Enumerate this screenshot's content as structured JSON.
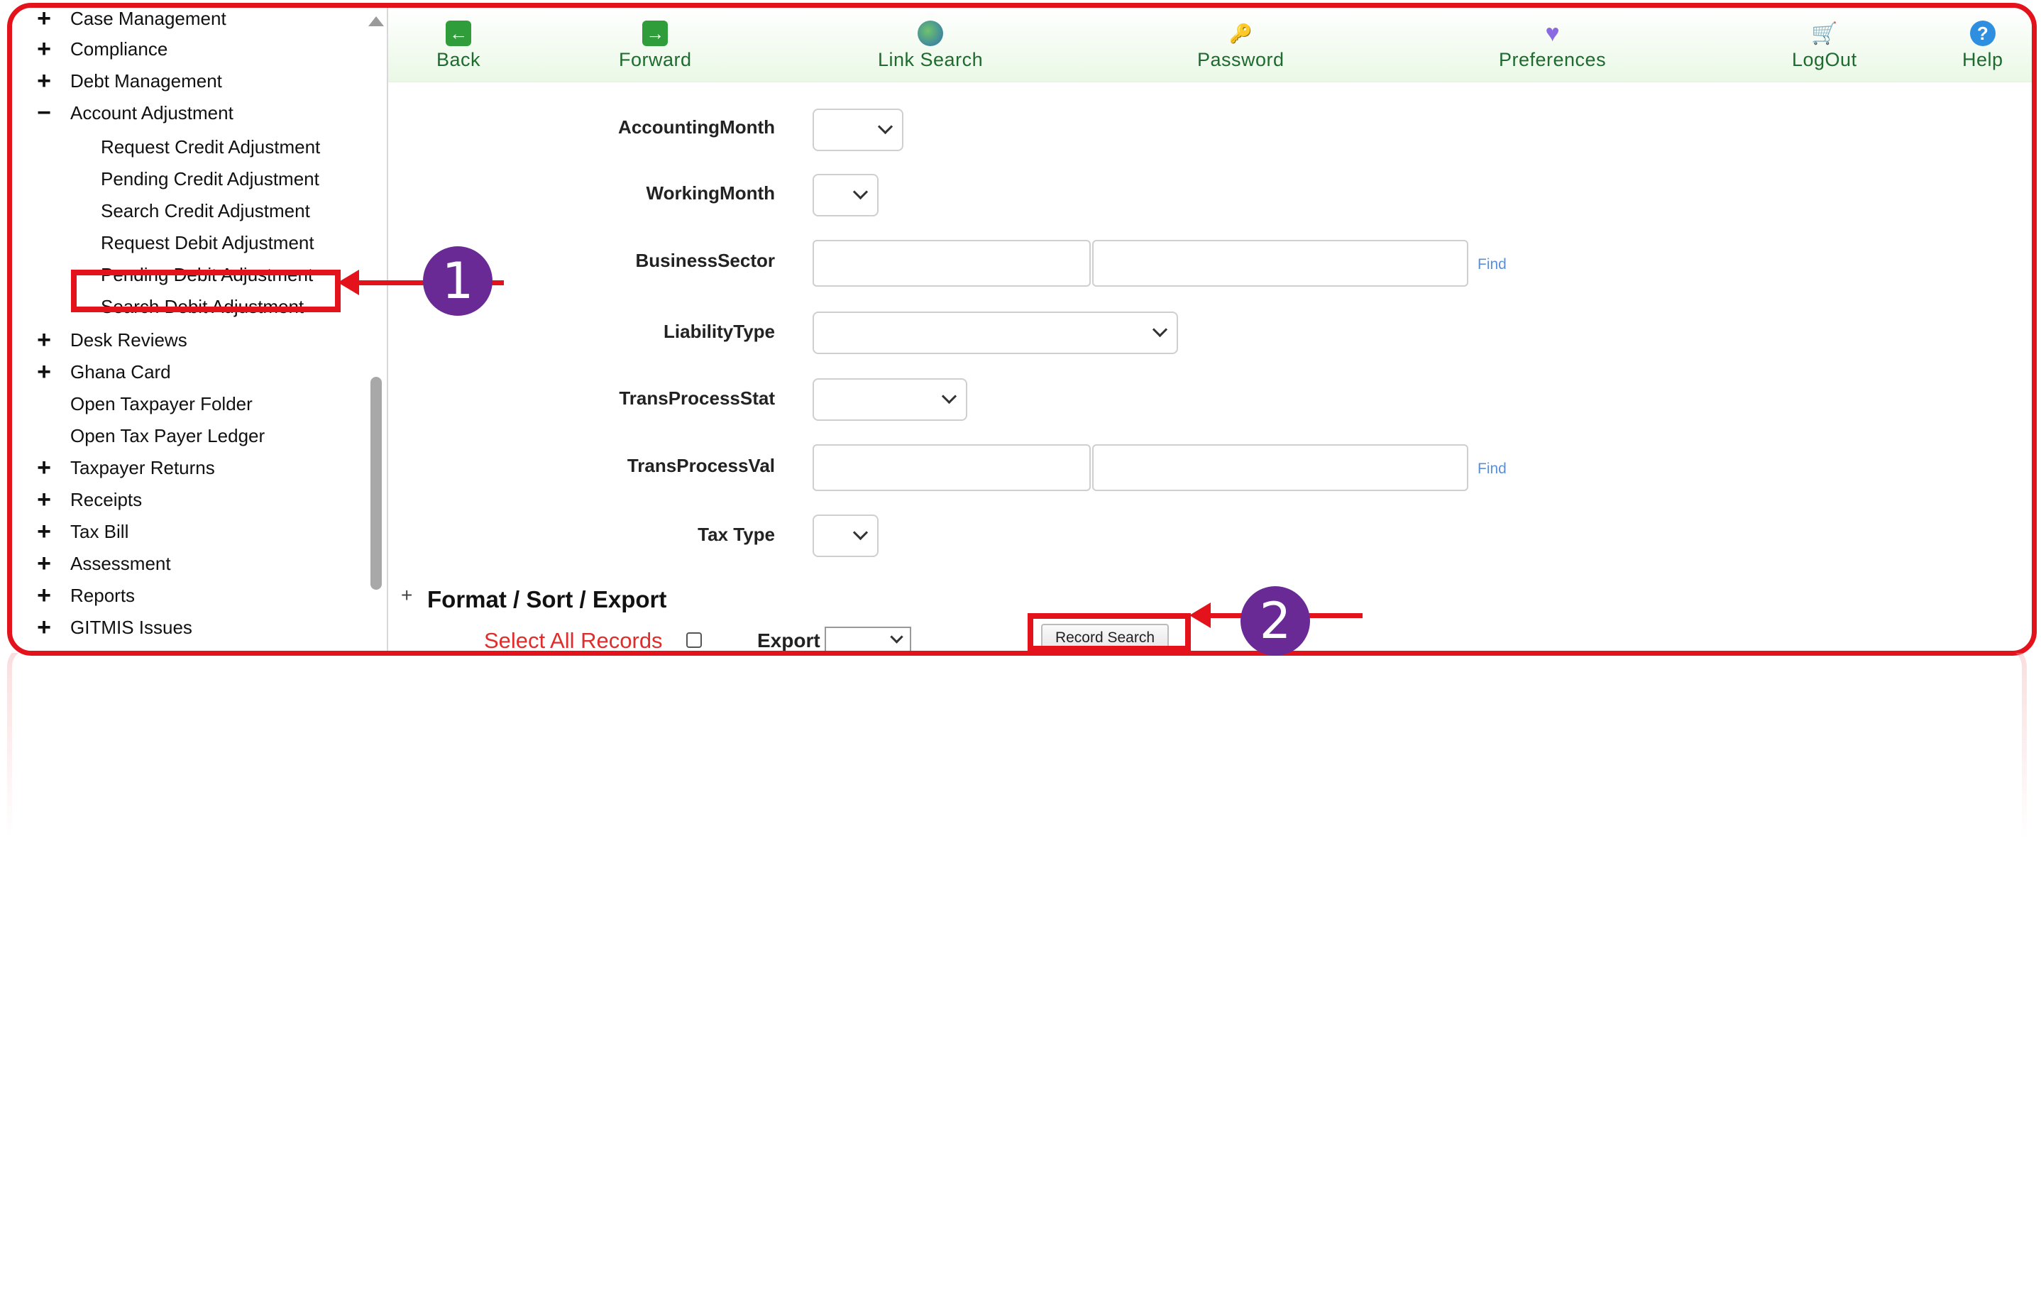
{
  "sidebar": {
    "items": [
      {
        "label": "Case Management",
        "sign": "+"
      },
      {
        "label": "Compliance",
        "sign": "+"
      },
      {
        "label": "Debt Management",
        "sign": "+"
      },
      {
        "label": "Account Adjustment",
        "sign": "−"
      },
      {
        "label": "Request Credit Adjustment",
        "sign": ""
      },
      {
        "label": "Pending Credit Adjustment",
        "sign": ""
      },
      {
        "label": "Search Credit Adjustment",
        "sign": ""
      },
      {
        "label": "Request Debit Adjustment",
        "sign": ""
      },
      {
        "label": "Pending Debit Adjustment",
        "sign": ""
      },
      {
        "label": "Search Debit Adjustment",
        "sign": ""
      },
      {
        "label": "Desk Reviews",
        "sign": "+"
      },
      {
        "label": "Ghana Card",
        "sign": "+"
      },
      {
        "label": "Open Taxpayer Folder",
        "sign": ""
      },
      {
        "label": "Open Tax Payer Ledger",
        "sign": ""
      },
      {
        "label": "Taxpayer Returns",
        "sign": "+"
      },
      {
        "label": "Receipts",
        "sign": "+"
      },
      {
        "label": "Tax Bill",
        "sign": "+"
      },
      {
        "label": "Assessment",
        "sign": "+"
      },
      {
        "label": "Reports",
        "sign": "+"
      },
      {
        "label": "GITMIS Issues",
        "sign": "+"
      }
    ]
  },
  "toolbar": {
    "back": "Back",
    "forward": "Forward",
    "link_search": "Link Search",
    "password": "Password",
    "preferences": "Preferences",
    "logout": "LogOut",
    "help": "Help"
  },
  "form": {
    "accounting_month": "AccountingMonth",
    "working_month": "WorkingMonth",
    "business_sector": "BusinessSector",
    "liability_type": "LiabilityType",
    "trans_process_stat": "TransProcessStat",
    "trans_process_val": "TransProcessVal",
    "tax_type": "Tax Type",
    "find": "Find"
  },
  "format_section": {
    "plus": "+",
    "title": "Format / Sort / Export",
    "select_all": "Select All Records",
    "export_label": "Export",
    "record_search": "Record Search"
  },
  "annotations": {
    "step1": "1",
    "step2": "2",
    "color": "#e3121b",
    "badge_color": "#6a2a96"
  },
  "colors": {
    "toolbar_label": "#1d6b2e",
    "link": "#5b8fd6",
    "select_all": "#e22b2b"
  }
}
